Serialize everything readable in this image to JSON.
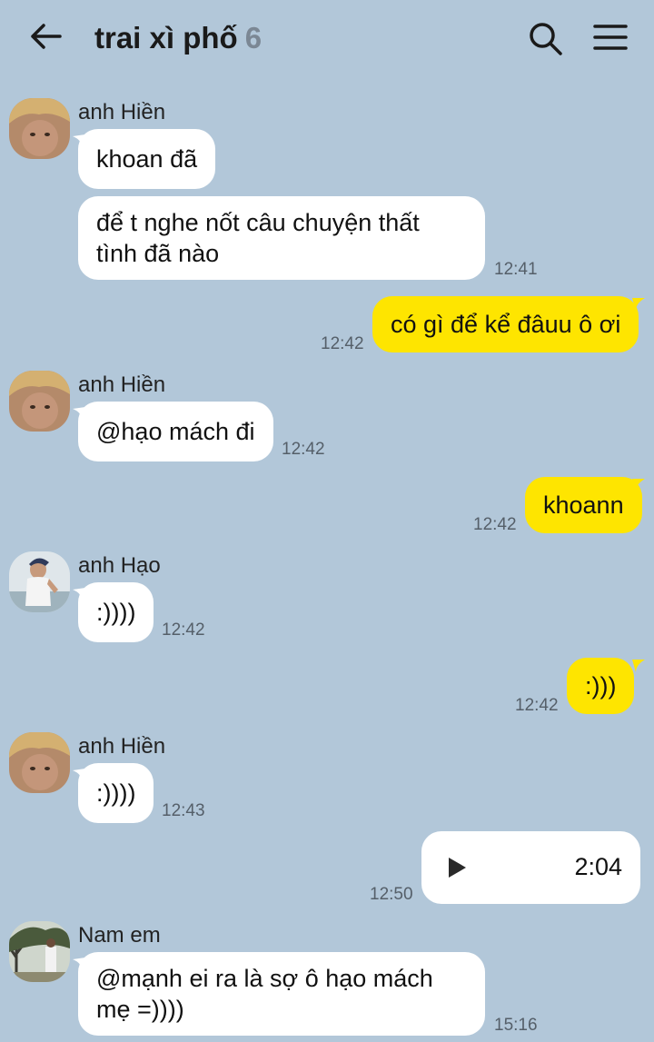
{
  "header": {
    "title": "trai xì phố",
    "member_count": "6",
    "back_icon": "arrow-left-icon",
    "search_icon": "search-icon",
    "menu_icon": "hamburger-menu-icon"
  },
  "colors": {
    "background": "#b2c7d9",
    "incoming_bubble": "#ffffff",
    "outgoing_bubble": "#fee500"
  },
  "messages": [
    {
      "sender": "anh Hiền",
      "text": "khoan đã"
    },
    {
      "text_line1": "để t nghe nốt câu chuyện thất",
      "text_line2": "tình đã nào",
      "time": "12:41"
    },
    {
      "text": "có gì để kể đâuu ô ơi",
      "time": "12:42"
    },
    {
      "sender": "anh Hiền",
      "text": "@hạo mách đi",
      "time": "12:42"
    },
    {
      "text": "khoann",
      "time": "12:42"
    },
    {
      "sender": "anh Hạo",
      "text": ":))))",
      "time": "12:42"
    },
    {
      "text": ":)))",
      "time": "12:42"
    },
    {
      "sender": "anh Hiền",
      "text": ":))))",
      "time": "12:43"
    },
    {
      "voice_duration": "2:04",
      "time": "12:50",
      "icon": "play-icon"
    },
    {
      "sender": "Nam em",
      "text_line1": "@mạnh ei ra là sợ ô hạo mách",
      "text_line2": "mẹ =))))",
      "time": "15:16"
    }
  ]
}
